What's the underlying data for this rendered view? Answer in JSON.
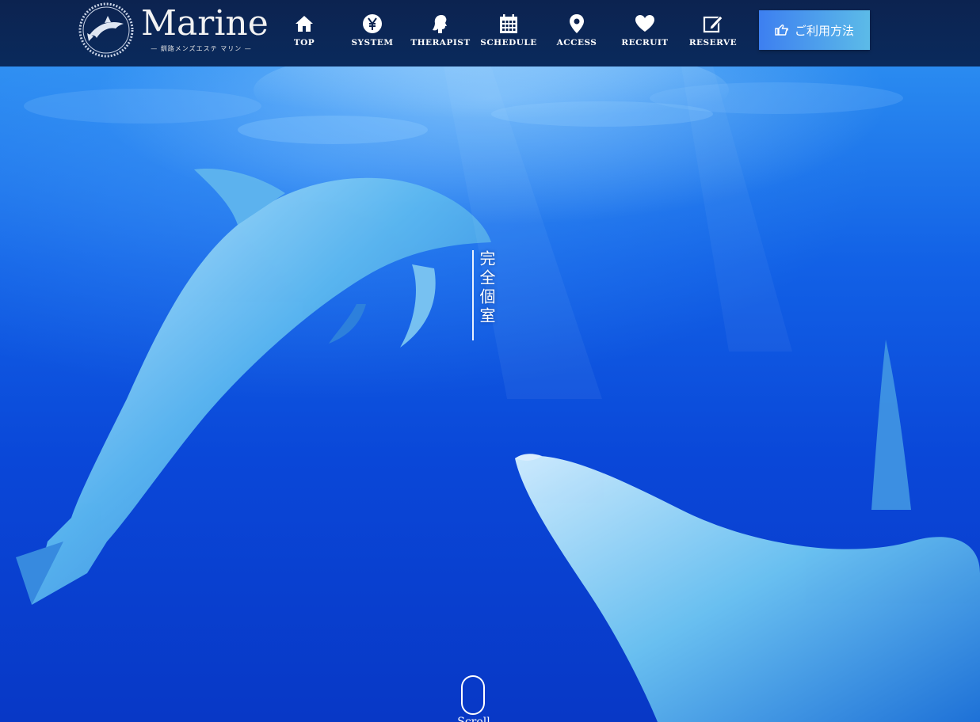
{
  "header": {
    "logo_text": "Marine",
    "logo_sub": "— 釧路メンズエステ マリン —",
    "nav": [
      {
        "label": "TOP",
        "icon": "home-icon"
      },
      {
        "label": "SYSTEM",
        "icon": "yen-icon"
      },
      {
        "label": "THERAPIST",
        "icon": "woman-profile-icon"
      },
      {
        "label": "SCHEDULE",
        "icon": "calendar-icon"
      },
      {
        "label": "ACCESS",
        "icon": "map-pin-icon"
      },
      {
        "label": "RECRUIT",
        "icon": "heart-icon"
      },
      {
        "label": "RESERVE",
        "icon": "edit-note-icon"
      }
    ],
    "guide_button": {
      "label": "ご利用方法",
      "icon": "pointing-hand-icon"
    }
  },
  "hero": {
    "vertical_text": "完全個室",
    "scroll_label": "Scroll"
  },
  "colors": {
    "header_bg": "#0c2350",
    "button_start": "#3d7ff0",
    "button_end": "#5cbbe8",
    "ocean": "#0a47d8"
  }
}
